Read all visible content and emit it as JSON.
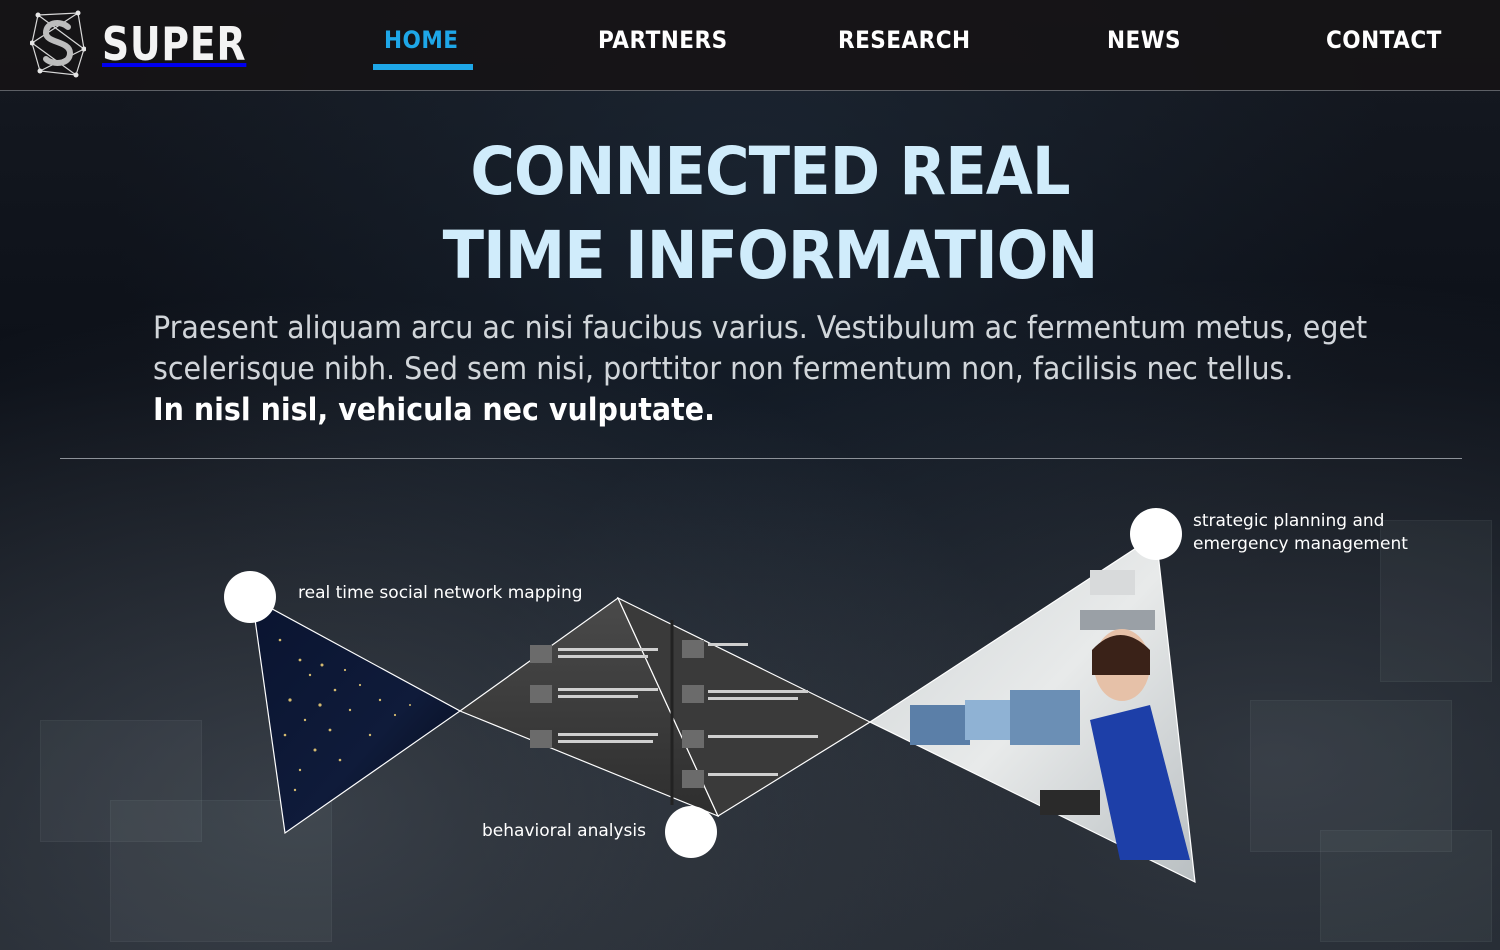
{
  "brand": {
    "name": "SUPER",
    "logo_icon": "s-network-logo-icon"
  },
  "nav": {
    "items": [
      {
        "label": "HOME",
        "active": true
      },
      {
        "label": "PARTNERS",
        "active": false
      },
      {
        "label": "RESEARCH",
        "active": false
      },
      {
        "label": "NEWS",
        "active": false
      },
      {
        "label": "CONTACT",
        "active": false
      }
    ]
  },
  "hero": {
    "title_line1": "CONNECTED REAL",
    "title_line2": "TIME INFORMATION",
    "text_line1": "Praesent aliquam arcu ac nisi faucibus varius. Vestibulum ac fermentum metus, eget",
    "text_line2": "scelerisque nibh. Sed sem nisi, porttitor non fermentum non, facilisis nec tellus.",
    "text_bold": "In nisl nisl, vehicula nec vulputate."
  },
  "features": [
    {
      "label": "real time social network mapping",
      "image": "night-earth-lights-image"
    },
    {
      "label": "behavioral analysis",
      "image": "social-feed-screenshot-image"
    },
    {
      "label_line1": "strategic planning and",
      "label_line2": "emergency management",
      "image": "control-room-operator-image"
    }
  ],
  "colors": {
    "accent": "#1ea7e8",
    "title": "#d0ecfb",
    "nav_bg": "#161416"
  }
}
